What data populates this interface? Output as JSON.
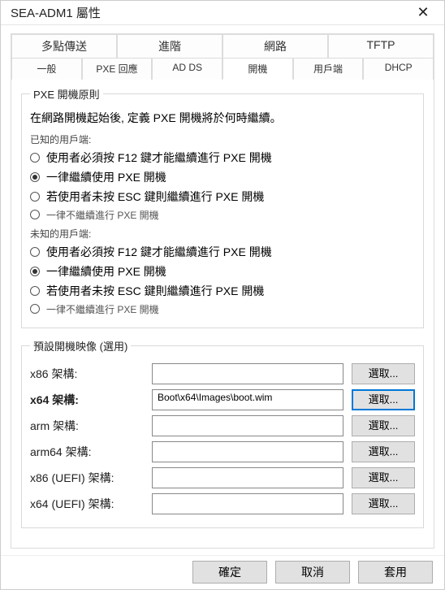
{
  "window": {
    "title": "SEA-ADM1 屬性",
    "close_icon": "✕"
  },
  "tabs": {
    "row1": [
      "多點傳送",
      "進階",
      "網路",
      "TFTP"
    ],
    "row2": [
      "一般",
      "PXE 回應",
      "AD DS",
      "開機",
      "用戶端",
      "DHCP"
    ],
    "active": "開機"
  },
  "policy": {
    "legend": "PXE 開機原則",
    "intro": "在網路開機起始後, 定義 PXE 開機將於何時繼續。",
    "known_label": "已知的用戶端:",
    "unknown_label": "未知的用戶端:",
    "opt_f12": "使用者必須按 F12 鍵才能繼續進行 PXE 開機",
    "opt_always": "一律繼續使用 PXE 開機",
    "opt_esc": "若使用者未按 ESC 鍵則繼續進行 PXE 開機",
    "opt_never": "一律不繼續進行 PXE 開機",
    "known_selected": 1,
    "unknown_selected": 1
  },
  "images": {
    "legend": "預設開機映像 (選用)",
    "browse": "選取...",
    "rows": [
      {
        "label": "x86 架構:",
        "value": ""
      },
      {
        "label": "x64 架構:",
        "value": "Boot\\x64\\Images\\boot.wim"
      },
      {
        "label": "arm 架構:",
        "value": ""
      },
      {
        "label": "arm64 架構:",
        "value": ""
      },
      {
        "label": "x86 (UEFI) 架構:",
        "value": ""
      },
      {
        "label": "x64 (UEFI) 架構:",
        "value": ""
      }
    ],
    "focused": 1
  },
  "buttons": {
    "ok": "確定",
    "cancel": "取消",
    "apply": "套用"
  }
}
